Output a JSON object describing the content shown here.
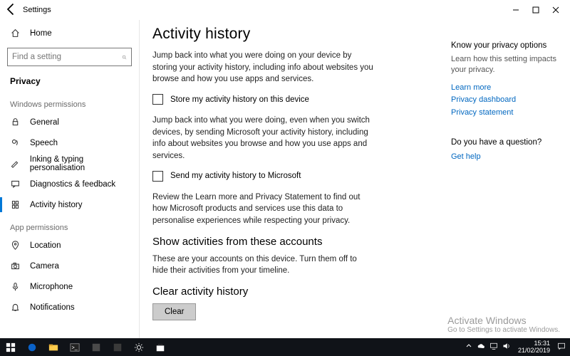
{
  "titlebar": {
    "title": "Settings"
  },
  "sidebar": {
    "home": "Home",
    "search_placeholder": "Find a setting",
    "crumb": "Privacy",
    "section1": "Windows permissions",
    "items1": [
      "General",
      "Speech",
      "Inking & typing personalisation",
      "Diagnostics & feedback",
      "Activity history"
    ],
    "section2": "App permissions",
    "items2": [
      "Location",
      "Camera",
      "Microphone",
      "Notifications"
    ]
  },
  "page": {
    "title": "Activity history",
    "p1": "Jump back into what you were doing on your device by storing your activity history, including info about websites you browse and how you use apps and services.",
    "chk1": "Store my activity history on this device",
    "p2": "Jump back into what you were doing, even when you switch devices, by sending Microsoft your activity history, including info about websites you browse and how you use apps and services.",
    "chk2": "Send my activity history to Microsoft",
    "p3": "Review the Learn more and Privacy Statement to find out how Microsoft products and services use this data to personalise experiences while respecting your privacy.",
    "sub1": "Show activities from these accounts",
    "p4": "These are your accounts on this device. Turn them off to hide their activities from your timeline.",
    "sub2": "Clear activity history",
    "clear_btn": "Clear"
  },
  "right": {
    "h1": "Know your privacy options",
    "d1": "Learn how this setting impacts your privacy.",
    "links1": [
      "Learn more",
      "Privacy dashboard",
      "Privacy statement"
    ],
    "h2": "Do you have a question?",
    "links2": [
      "Get help"
    ]
  },
  "watermark": {
    "l1": "Activate Windows",
    "l2": "Go to Settings to activate Windows."
  },
  "taskbar": {
    "time": "15:31",
    "date": "21/02/2019"
  }
}
